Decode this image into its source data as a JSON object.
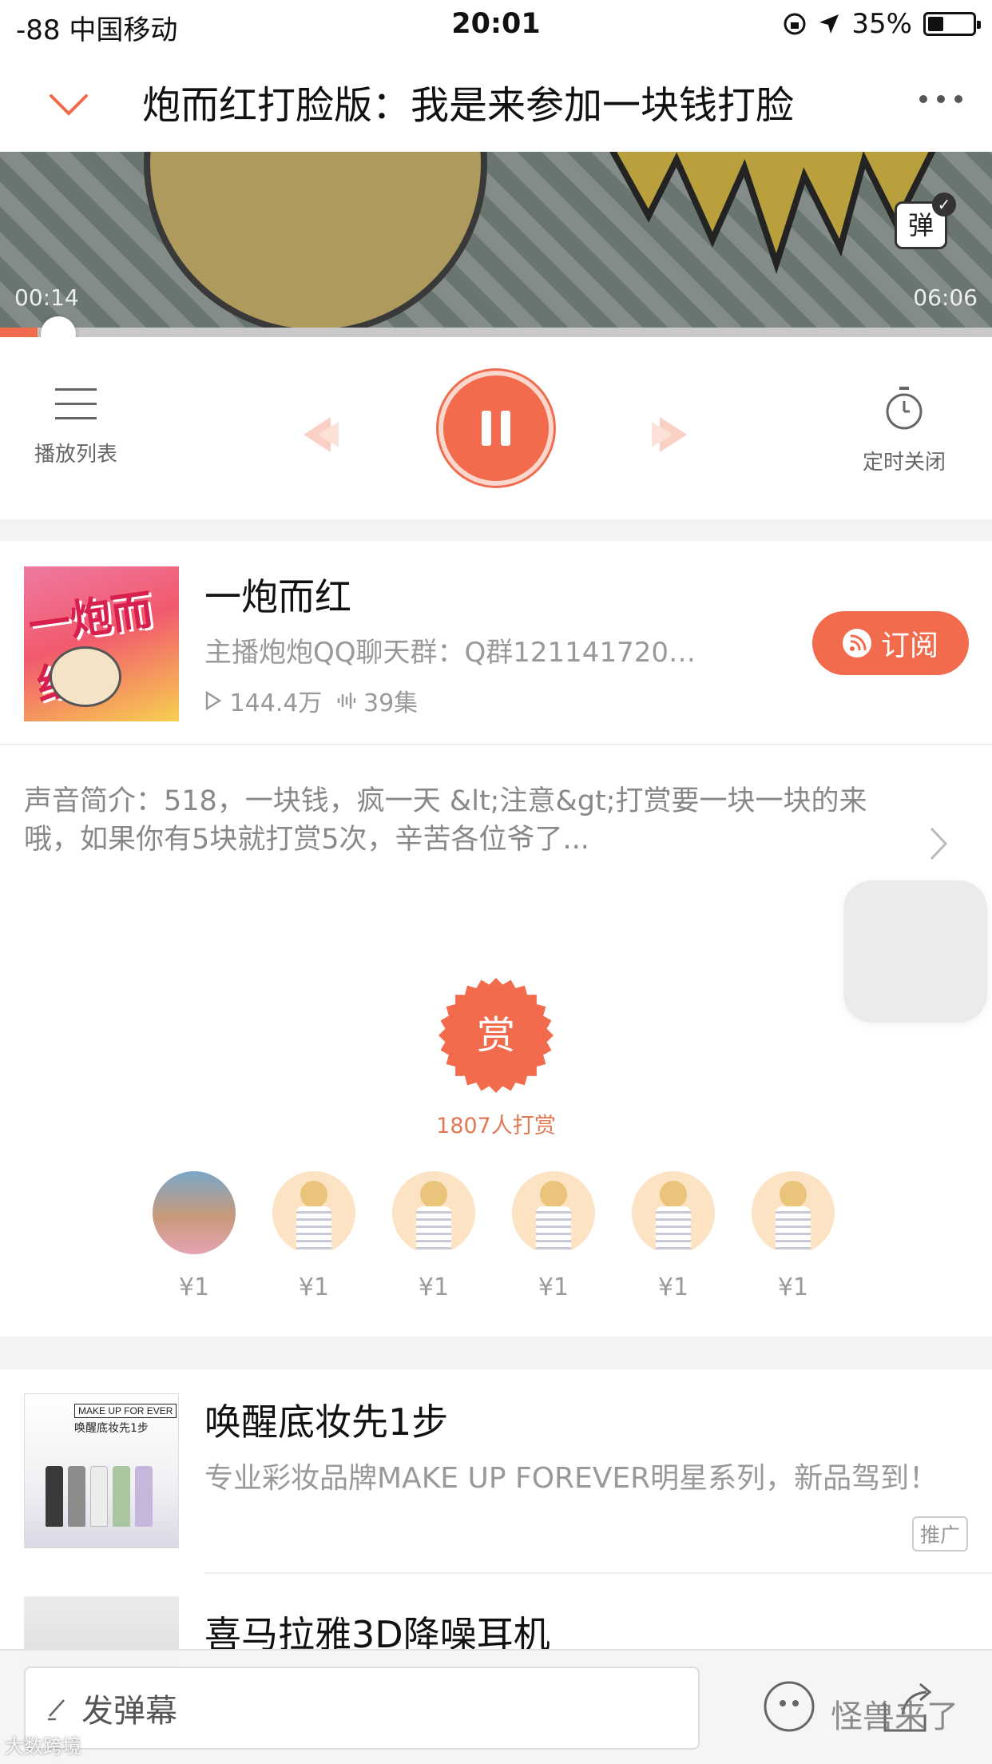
{
  "status_bar": {
    "carrier": "-88 中国移动",
    "time": "20:01",
    "battery": "35%",
    "battery_level": 0.35
  },
  "header": {
    "title": "炮而红打脸版：我是来参加一块钱打脸"
  },
  "player": {
    "current_time": "00:14",
    "total_time": "06:06",
    "progress": 0.038,
    "danmaku_toggle": "弹",
    "playlist_label": "播放列表",
    "timer_label": "定时关闭"
  },
  "album": {
    "title": "一炮而红",
    "cover_title": "一炮而红",
    "description": "主播炮炮QQ聊天群：Q群121141720…",
    "plays": "144.4万",
    "episodes": "39集",
    "subscribe_label": "订阅"
  },
  "intro": {
    "text": "声音简介：518，一块钱，疯一天 &lt;注意&gt;打赏要一块一块的来哦，如果你有5块就打赏5次，辛苦各位爷了..."
  },
  "reward": {
    "badge": "赏",
    "count_text": "1807人打赏",
    "rewarders": [
      {
        "amount": "¥1"
      },
      {
        "amount": "¥1"
      },
      {
        "amount": "¥1"
      },
      {
        "amount": "¥1"
      },
      {
        "amount": "¥1"
      },
      {
        "amount": "¥1"
      }
    ]
  },
  "ads": [
    {
      "title": "唤醒底妆先1步",
      "description": "专业彩妆品牌MAKE UP FOREVER明星系列，新品驾到！",
      "tag": "推广",
      "thumb_brand": "MAKE UP FOR EVER",
      "thumb_text": "唤醒底妆先1步"
    },
    {
      "title": "喜马拉雅3D降噪耳机"
    }
  ],
  "bottom_bar": {
    "danmaku_placeholder": "发弹幕"
  },
  "watermarks": {
    "right": "怪兽来了",
    "left": "大数跨境"
  },
  "colors": {
    "accent": "#f26b4d",
    "progress_track": "#c9c9c9",
    "reward_text": "#e07a55"
  }
}
